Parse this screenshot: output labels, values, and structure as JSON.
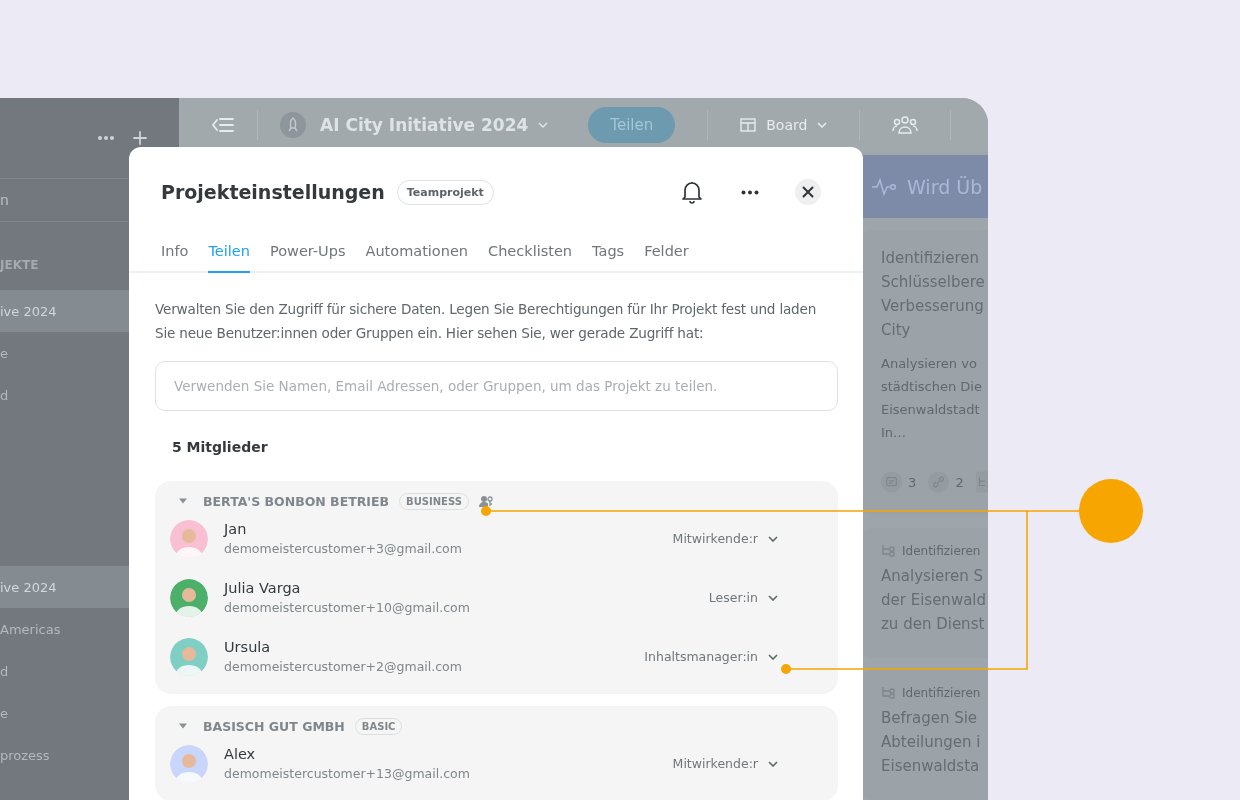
{
  "sidebar": {
    "search_placeholder": "n",
    "section_title": "JEKTE",
    "groups": [
      {
        "items": [
          {
            "label": "ive 2024",
            "selected": true
          },
          {
            "label": "e",
            "selected": false
          },
          {
            "label": "d",
            "selected": false
          }
        ]
      },
      {
        "items": [
          {
            "label": "ive 2024",
            "selected": true
          },
          {
            "label": "Americas",
            "selected": false
          },
          {
            "label": "d",
            "selected": false
          },
          {
            "label": "e",
            "selected": false
          },
          {
            "label": "prozess",
            "selected": false
          }
        ]
      }
    ]
  },
  "topbar": {
    "project": "AI City Initiative 2024",
    "share_button": "Teilen",
    "view": "Board"
  },
  "board": {
    "column_title": "Wird Üb",
    "cards": [
      {
        "kind": "task",
        "title_lines": [
          "Identifizieren",
          "Schlüsselbere",
          "Verbesserung",
          "City"
        ],
        "description_lines": [
          "Analysieren vo",
          "städtischen Die",
          "Eisenwaldstadt",
          "In…"
        ],
        "counts": [
          {
            "kind": "comments",
            "value": "3"
          },
          {
            "kind": "links",
            "value": "2"
          },
          {
            "kind": "subtasks"
          }
        ]
      },
      {
        "kind": "subtask",
        "parent": "Identifizieren",
        "title_lines": [
          "Analysieren S",
          "der Eisenwald",
          "zu den Dienst"
        ]
      },
      {
        "kind": "subtask",
        "parent": "Identifizieren",
        "title_lines": [
          "Befragen Sie",
          "Abteilungen i",
          "Eisenwaldsta"
        ]
      }
    ]
  },
  "modal": {
    "title": "Projekteinstellungen",
    "badge": "Teamprojekt",
    "tabs": [
      {
        "label": "Info",
        "selected": false
      },
      {
        "label": "Teilen",
        "selected": true
      },
      {
        "label": "Power-Ups",
        "selected": false
      },
      {
        "label": "Automationen",
        "selected": false
      },
      {
        "label": "Checklisten",
        "selected": false
      },
      {
        "label": "Tags",
        "selected": false
      },
      {
        "label": "Felder",
        "selected": false
      }
    ],
    "description": "Verwalten Sie den Zugriff für sichere Daten. Legen Sie Berechtigungen für Ihr Projekt fest und laden Sie neue Benutzer:innen oder Gruppen ein. Hier sehen Sie, wer gerade Zugriff hat:",
    "search": {
      "placeholder": "Verwenden Sie Namen, Email Adressen, oder Gruppen, um das Projekt zu teilen."
    },
    "member_count": "5 Mitglieder",
    "groups": [
      {
        "name": "BERTA'S BONBON BETRIEB",
        "plan": "BUSINESS",
        "expanded": true,
        "admin_icon": true,
        "members": [
          {
            "name": "Jan",
            "email": "demomeistercustomer+3@gmail.com",
            "role": "Mitwirkende:r",
            "color": "#f9bfd3"
          },
          {
            "name": "Julia Varga",
            "email": "demomeistercustomer+10@gmail.com",
            "role": "Leser:in",
            "color": "#4caf6a"
          },
          {
            "name": "Ursula",
            "email": "demomeistercustomer+2@gmail.com",
            "role": "Inhaltsmanager:in",
            "color": "#7fcfc4"
          }
        ]
      },
      {
        "name": "BASISCH GUT GMBH",
        "plan": "BASIC",
        "expanded": true,
        "admin_icon": false,
        "members": [
          {
            "name": "Alex",
            "email": "demomeistercustomer+13@gmail.com",
            "role": "Mitwirkende:r",
            "color": "#c9d6fb"
          }
        ]
      }
    ]
  }
}
